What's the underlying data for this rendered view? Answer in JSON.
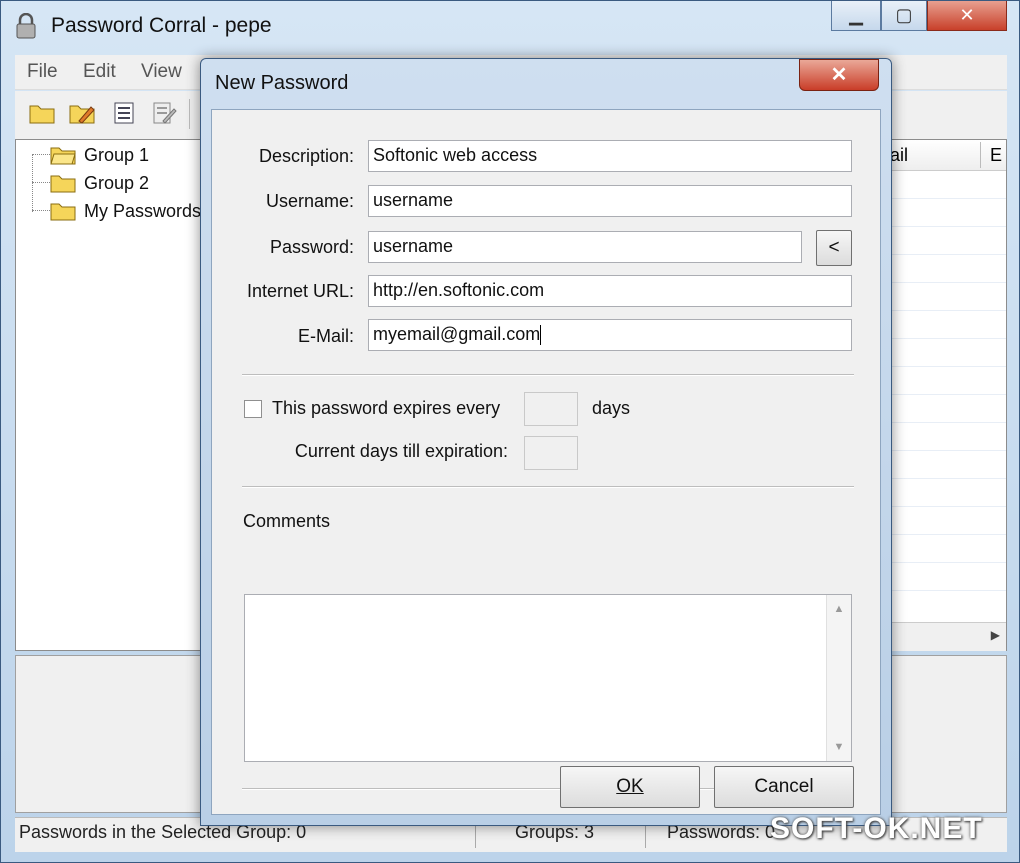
{
  "app": {
    "title": "Password Corral - pepe",
    "window_buttons": {
      "minimize": "▁",
      "maximize": "▢",
      "close": "✕"
    }
  },
  "menu": {
    "items": [
      "File",
      "Edit",
      "View"
    ]
  },
  "toolbar": {
    "icons": [
      "open-folder-icon",
      "edit-folder-icon",
      "list-icon",
      "edit-entry-icon"
    ]
  },
  "tree": {
    "items": [
      {
        "label": "Group 1"
      },
      {
        "label": "Group 2"
      },
      {
        "label": "My Passwords"
      }
    ]
  },
  "list": {
    "headers": [
      "ail",
      "E"
    ]
  },
  "status": {
    "passwords_in_group": "Passwords in the Selected Group: 0",
    "groups": "Groups: 3",
    "passwords": "Passwords: 0"
  },
  "dialog": {
    "title": "New Password",
    "close": "✕",
    "description": {
      "label": "Description:",
      "value": "Softonic web access"
    },
    "username": {
      "label": "Username:",
      "value": "username"
    },
    "password": {
      "label": "Password:",
      "value": "username",
      "toggle": "<"
    },
    "url": {
      "label": "Internet URL:",
      "value": "http://en.softonic.com"
    },
    "email": {
      "label": "E-Mail:",
      "value": "myemail@gmail.com"
    },
    "expires": {
      "label": "This password expires every",
      "days_value": "",
      "unit": "days",
      "checked": false
    },
    "current_days": {
      "label": "Current days till expiration:",
      "value": ""
    },
    "comments": {
      "label": "Comments",
      "value": ""
    },
    "ok": "OK",
    "cancel": "Cancel"
  },
  "watermark": "SOFT-OK.NET"
}
